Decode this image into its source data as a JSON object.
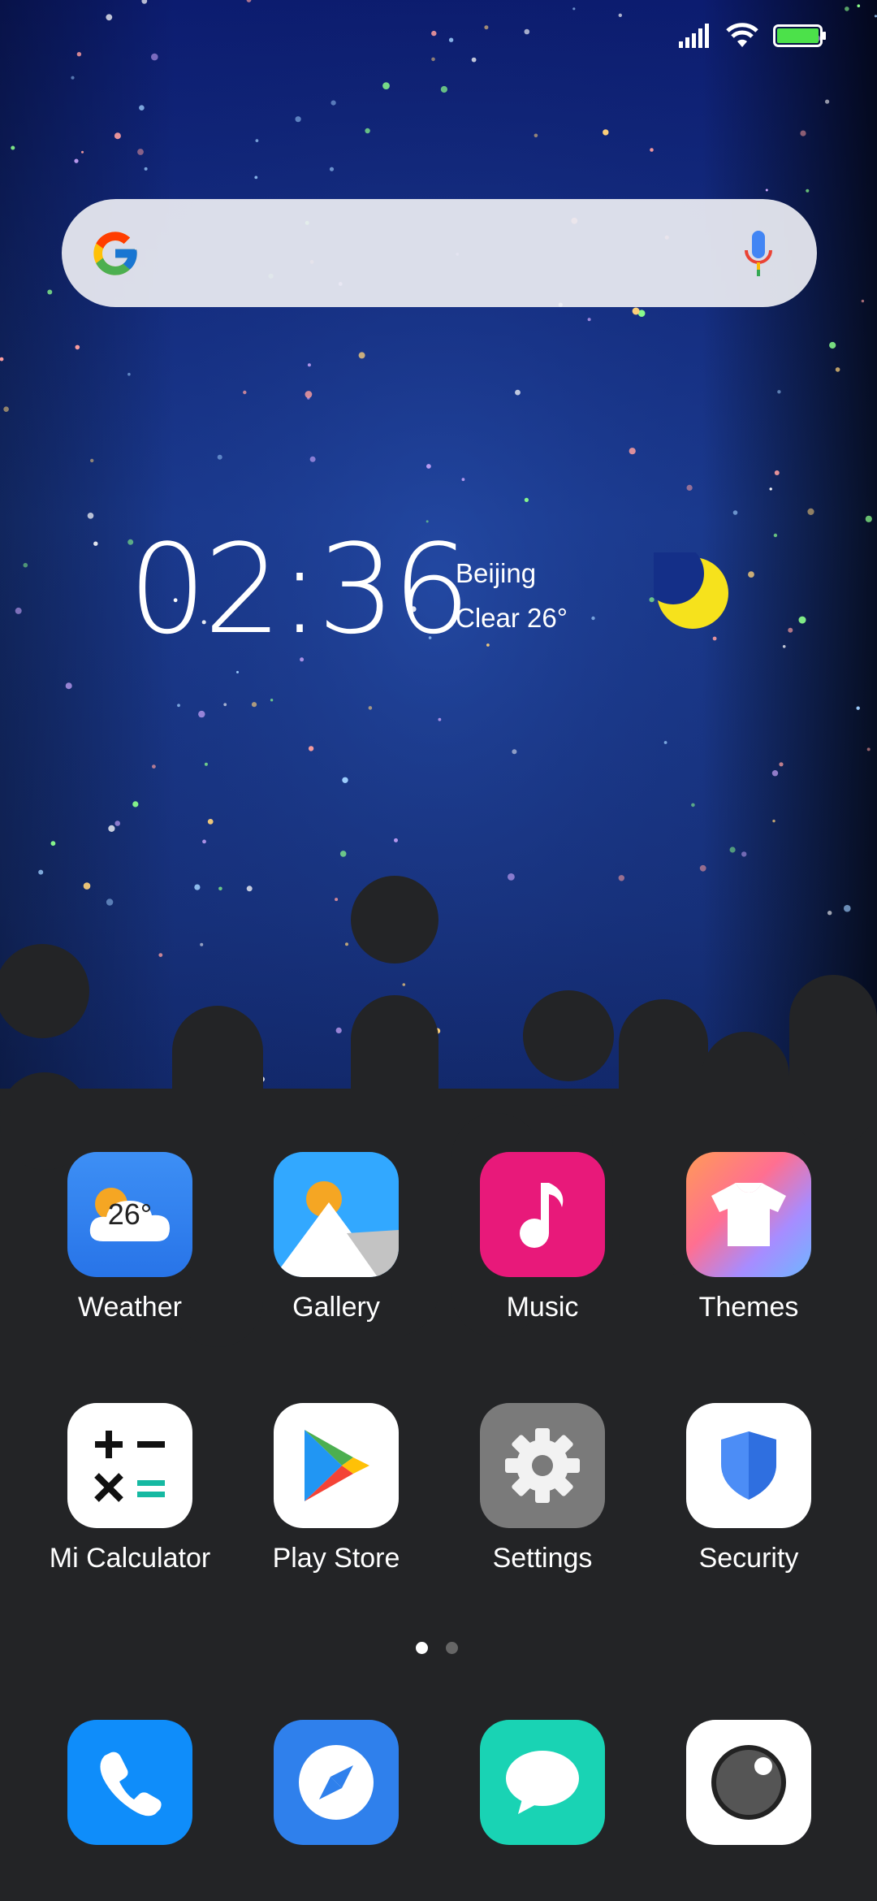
{
  "status_bar": {
    "signal": "signal-icon",
    "wifi": "wifi-icon",
    "battery": "battery-icon"
  },
  "search": {
    "placeholder": "",
    "logo": "google-logo-icon",
    "mic": "mic-icon"
  },
  "clock": {
    "time": "02:36"
  },
  "weather_widget": {
    "city": "Beijing",
    "condition": "Clear 26°",
    "icon": "moon-icon"
  },
  "apps": [
    {
      "label": "Weather",
      "icon": "weather-icon",
      "badge": "26°"
    },
    {
      "label": "Gallery",
      "icon": "gallery-icon"
    },
    {
      "label": "Music",
      "icon": "music-icon"
    },
    {
      "label": "Themes",
      "icon": "themes-icon"
    },
    {
      "label": "Mi Calculator",
      "icon": "calculator-icon"
    },
    {
      "label": "Play Store",
      "icon": "play-store-icon"
    },
    {
      "label": "Settings",
      "icon": "settings-icon"
    },
    {
      "label": "Security",
      "icon": "security-icon"
    }
  ],
  "page_indicator": {
    "pages": 2,
    "current": 1
  },
  "dock": [
    {
      "icon": "phone-icon"
    },
    {
      "icon": "browser-icon"
    },
    {
      "icon": "messaging-icon"
    },
    {
      "icon": "camera-icon"
    }
  ],
  "colors": {
    "background": "#232426",
    "sky_top": "#0b1b6e",
    "sky_mid": "#1e3e96"
  }
}
